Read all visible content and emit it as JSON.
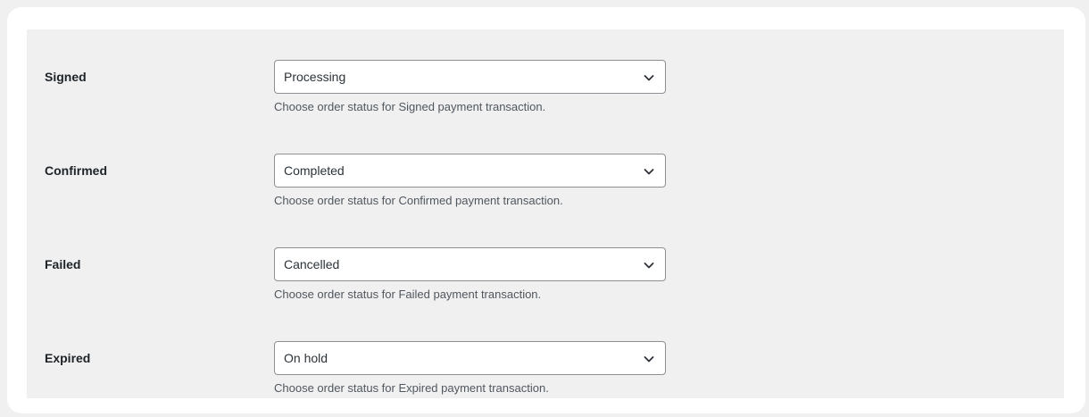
{
  "settings": {
    "rows": [
      {
        "label": "Signed",
        "selected": "Processing",
        "description": "Choose order status for Signed payment transaction."
      },
      {
        "label": "Confirmed",
        "selected": "Completed",
        "description": "Choose order status for Confirmed payment transaction."
      },
      {
        "label": "Failed",
        "selected": "Cancelled",
        "description": "Choose order status for Failed payment transaction."
      },
      {
        "label": "Expired",
        "selected": "On hold",
        "description": "Choose order status for Expired payment transaction."
      }
    ]
  },
  "icons": {
    "dropdown": "chevron-down-icon"
  },
  "colors": {
    "page_background": "#f0f0f1",
    "card_background": "#ffffff",
    "panel_background": "#f0f0f1",
    "select_border": "#8c8f94",
    "label_text": "#1d2327",
    "description_text": "#50575e"
  }
}
